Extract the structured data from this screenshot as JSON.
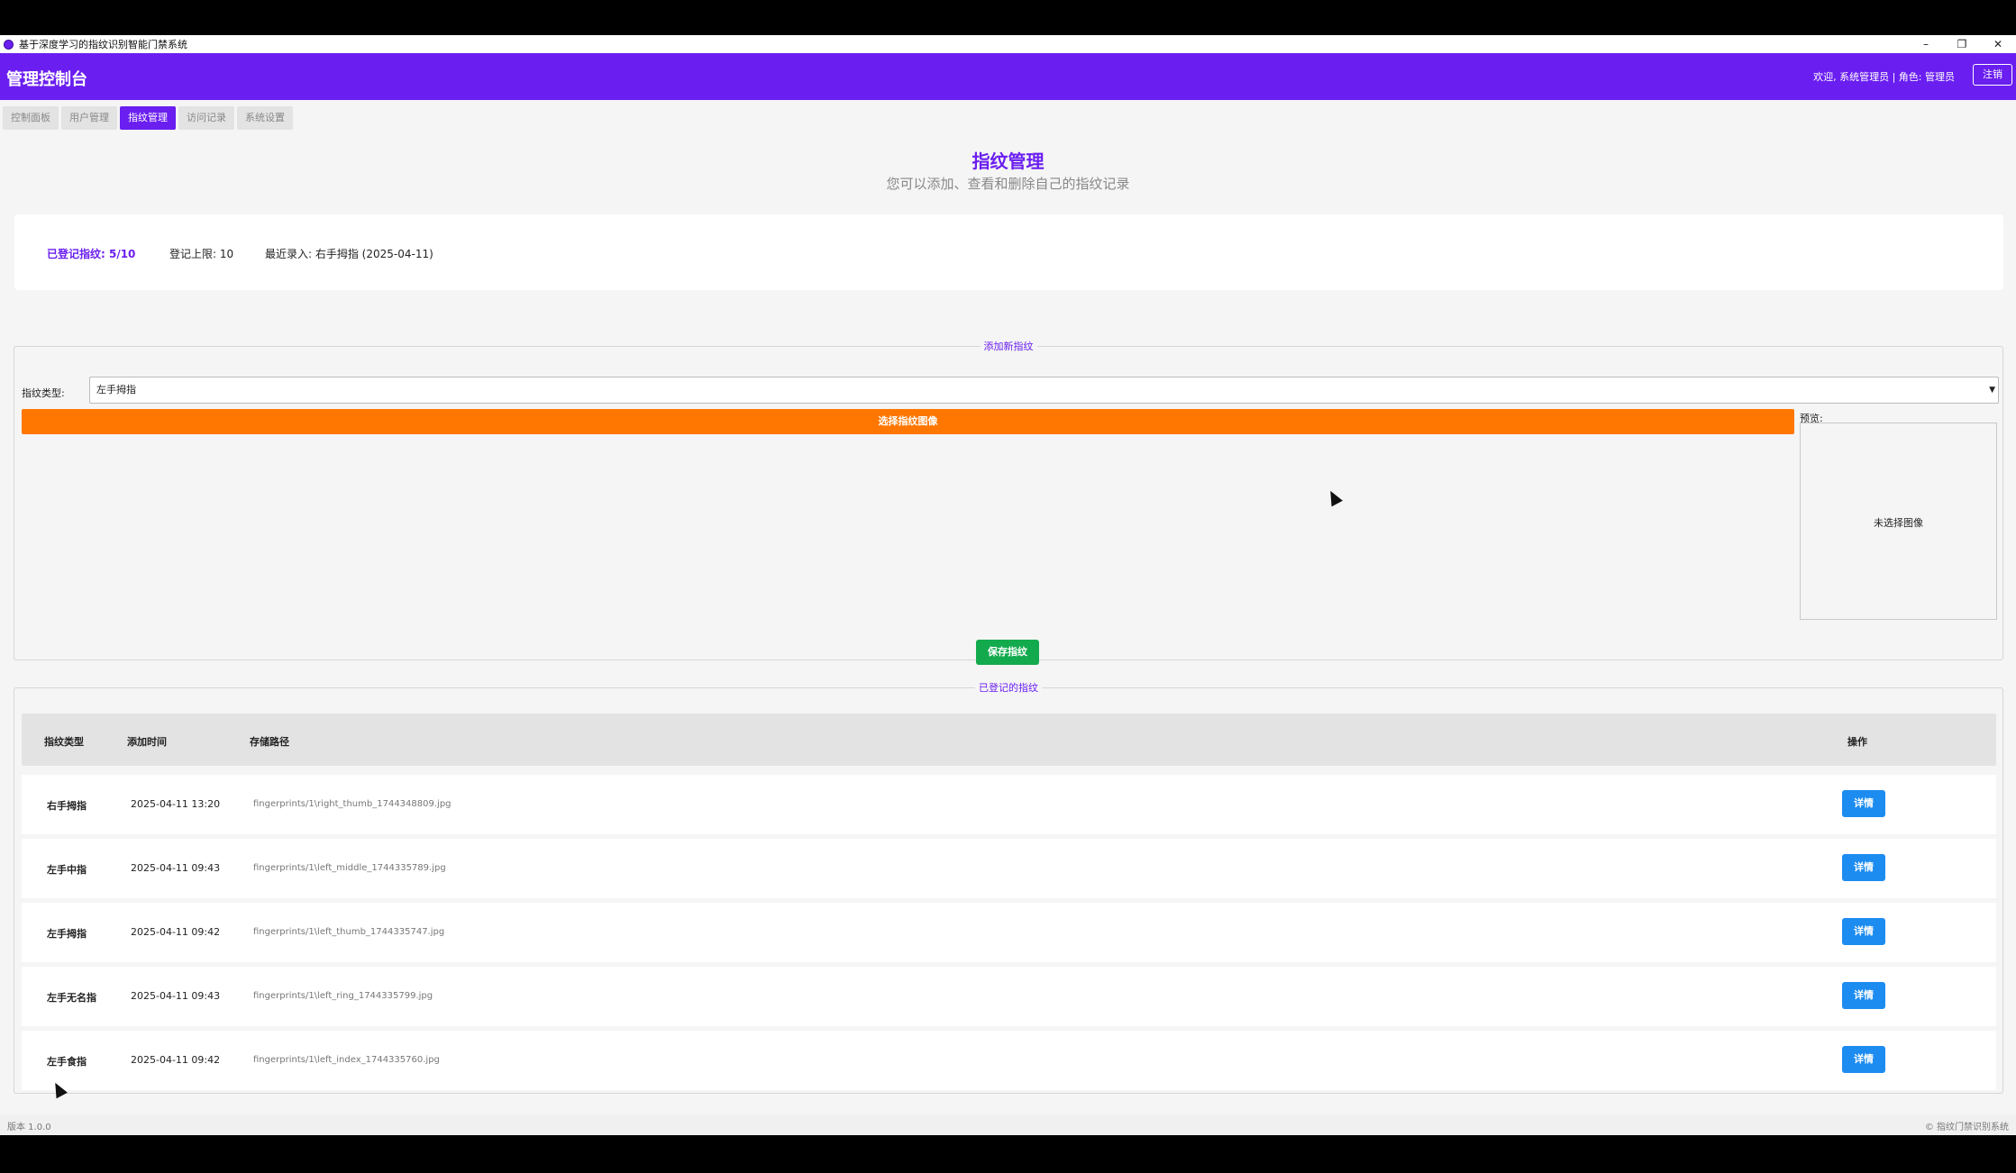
{
  "window": {
    "title": "基于深度学习的指纹识别智能门禁系统",
    "controls": [
      "–",
      "❐",
      "✕"
    ]
  },
  "header": {
    "brand": "管理控制台",
    "welcome": "欢迎, 系统管理员 | 角色: 管理员",
    "logout": "注销"
  },
  "tabs": [
    {
      "label": "控制面板",
      "active": false
    },
    {
      "label": "用户管理",
      "active": false
    },
    {
      "label": "指纹管理",
      "active": true
    },
    {
      "label": "访问记录",
      "active": false
    },
    {
      "label": "系统设置",
      "active": false
    }
  ],
  "page": {
    "title": "指纹管理",
    "subtitle": "您可以添加、查看和删除自己的指纹记录"
  },
  "stats": {
    "registered": "已登记指纹: 5/10",
    "limit": "登记上限: 10",
    "recent": "最近录入: 右手拇指 (2025-04-11)"
  },
  "add_section": {
    "legend": "添加新指纹",
    "type_label": "指纹类型:",
    "type_value": "左手拇指",
    "choose_button": "选择指纹图像",
    "preview_label": "预览:",
    "preview_empty": "未选择图像",
    "save_button": "保存指纹"
  },
  "list_section": {
    "legend": "已登记的指纹",
    "columns": [
      "指纹类型",
      "添加时间",
      "存储路径",
      "操作"
    ],
    "rows": [
      {
        "type": "右手拇指",
        "time": "2025-04-11 13:20",
        "path": "fingerprints/1\\right_thumb_1744348809.jpg",
        "action": "详情"
      },
      {
        "type": "左手中指",
        "time": "2025-04-11 09:43",
        "path": "fingerprints/1\\left_middle_1744335789.jpg",
        "action": "详情"
      },
      {
        "type": "左手拇指",
        "time": "2025-04-11 09:42",
        "path": "fingerprints/1\\left_thumb_1744335747.jpg",
        "action": "详情"
      },
      {
        "type": "左手无名指",
        "time": "2025-04-11 09:43",
        "path": "fingerprints/1\\left_ring_1744335799.jpg",
        "action": "详情"
      },
      {
        "type": "左手食指",
        "time": "2025-04-11 09:42",
        "path": "fingerprints/1\\left_index_1744335760.jpg",
        "action": "详情"
      }
    ]
  },
  "footer": {
    "version": "版本 1.0.0",
    "copyright": "© 指纹门禁识别系统"
  },
  "colors": {
    "primary": "#6a1ef0",
    "orange": "#ff7700",
    "green": "#13aa4e",
    "blue": "#1d8cf0"
  }
}
